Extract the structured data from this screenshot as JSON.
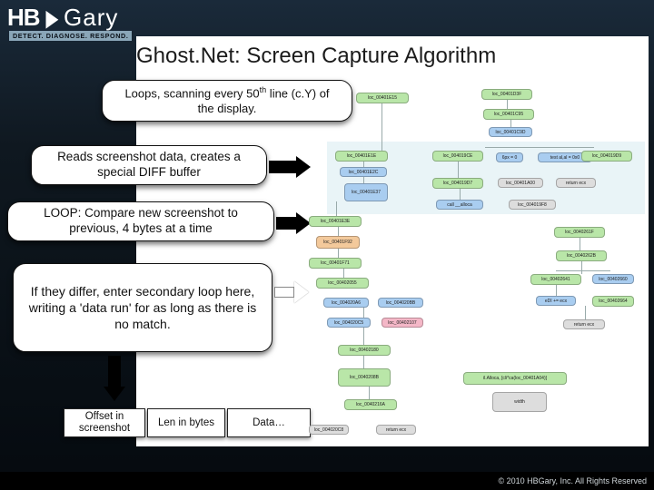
{
  "brand": {
    "hb": "HB",
    "gary": "Gary",
    "tagline": "DETECT. DIAGNOSE. RESPOND."
  },
  "title": "Ghost.Net: Screen Capture Algorithm",
  "callouts": {
    "c1_pre": "Loops, scanning every 50",
    "c1_ord": "th",
    "c1_post": " line (c.Y) of the display.",
    "c2": "Reads screenshot data, creates a special DIFF buffer",
    "c3": "LOOP: Compare new screenshot to previous, 4 bytes at a time",
    "c4": "If they differ, enter secondary loop here, writing a 'data run' for as long as there is no match."
  },
  "row": {
    "b1": "Offset in screenshot",
    "b2": "Len in bytes",
    "b3": "Data…"
  },
  "nodes": {
    "n0": "loc_00401E15",
    "n1": "loc_00401E1E",
    "n2": "loc_00401E2C",
    "n3": "loc_00401E37",
    "n4": "loc_00401E3E",
    "n5": "loc_00401F92",
    "n6": "loc_00401F71",
    "n7": "loc_00402055",
    "n8": "loc_004020A6",
    "n9": "loc_004020BB",
    "n10": "loc_004020C5",
    "n11": "loc_00402107",
    "n12": "loc_00402180",
    "n13": "loc_0040208B",
    "n14": "loc_0040216A",
    "n15": "loc_004020C8",
    "n16": "return ecx",
    "t0": "loc_00401D3F",
    "t1": "loc_00401C95",
    "t2": "loc_00401C9D",
    "t3": "loc_004019CE",
    "t4": "loc_004019D7",
    "t5": "6px = 0",
    "t6": "test al,al = 0x0",
    "t7": "return ecx",
    "t8": "loc_00401A00",
    "t9": "call __alloca",
    "t10": "il.Alloca, [cli*ca(loc_00401A04)]",
    "t11": "width",
    "r0": "loc_004019D9",
    "r1": "loc_004019F8",
    "r2": "loc_0040261F",
    "r3": "loc_0040262B",
    "r4": "loc_00402641",
    "r5": "loc_00402660",
    "r6": "loc_00402664",
    "r7": "eDI += ecx",
    "r8": "return ecx"
  },
  "footer": "© 2010 HBGary, Inc. All Rights Reserved"
}
